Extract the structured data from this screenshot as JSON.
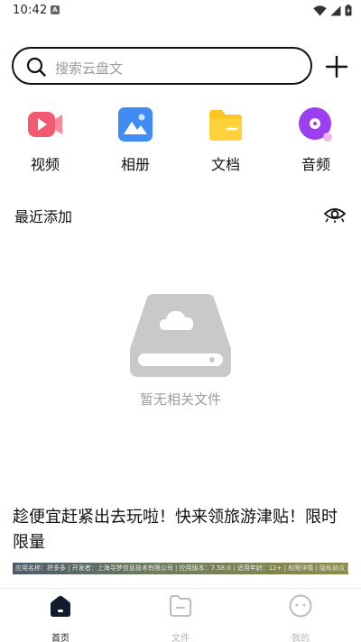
{
  "status": {
    "time": "10:42",
    "notification_glyph": "A"
  },
  "search": {
    "placeholder": "搜索云盘文"
  },
  "categories": [
    {
      "label": "视频",
      "icon": "video-icon",
      "color": "#f25a6f"
    },
    {
      "label": "相册",
      "icon": "album-icon",
      "color": "#3f8cf5"
    },
    {
      "label": "文档",
      "icon": "document-icon",
      "color": "#ffc524"
    },
    {
      "label": "音频",
      "icon": "audio-icon",
      "color": "#9b3ff0"
    }
  ],
  "recent": {
    "title": "最近添加"
  },
  "empty": {
    "text": "暂无相关文件"
  },
  "promo": {
    "title": "趁便宜赶紧出去玩啦！快来领旅游津贴！限时限量",
    "banner_text": "应用名称：拼多多 | 开发者：上海寻梦信息技术有限公司 | 应用版本：7.58.0 | 适用年龄：12+ | 权限详情 | 隐私协议 |"
  },
  "bottom_nav": [
    {
      "label": "首页",
      "icon": "home-icon",
      "active": true
    },
    {
      "label": "文件",
      "icon": "files-icon",
      "active": false
    },
    {
      "label": "我的",
      "icon": "profile-icon",
      "active": false
    }
  ],
  "colors": {
    "accent": "#111111",
    "muted": "#9c9c9c",
    "empty_illustration": "#c9c9c9"
  }
}
